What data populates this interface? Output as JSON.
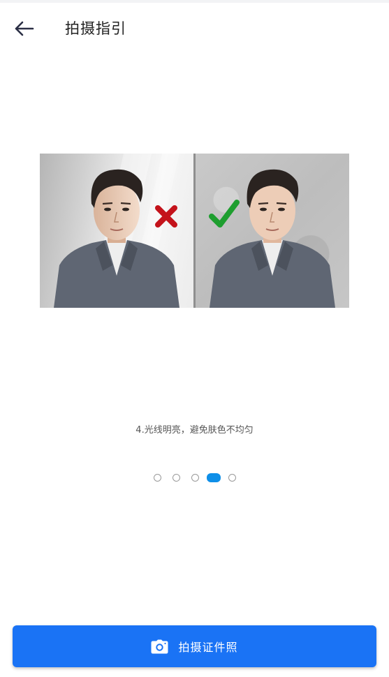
{
  "header": {
    "back_icon": "arrow-left-icon",
    "title": "拍摄指引"
  },
  "guide": {
    "wrong_icon": "cross-icon",
    "right_icon": "check-icon",
    "colors": {
      "wrong": "#c4131b",
      "right": "#1e9e2f"
    },
    "caption": "4.光线明亮，避免肤色不均匀"
  },
  "pager": {
    "count": 5,
    "active_index": 3,
    "active_color": "#0e8fe8"
  },
  "action": {
    "icon": "camera-icon",
    "label": "拍摄证件照",
    "color": "#1a73f5"
  }
}
